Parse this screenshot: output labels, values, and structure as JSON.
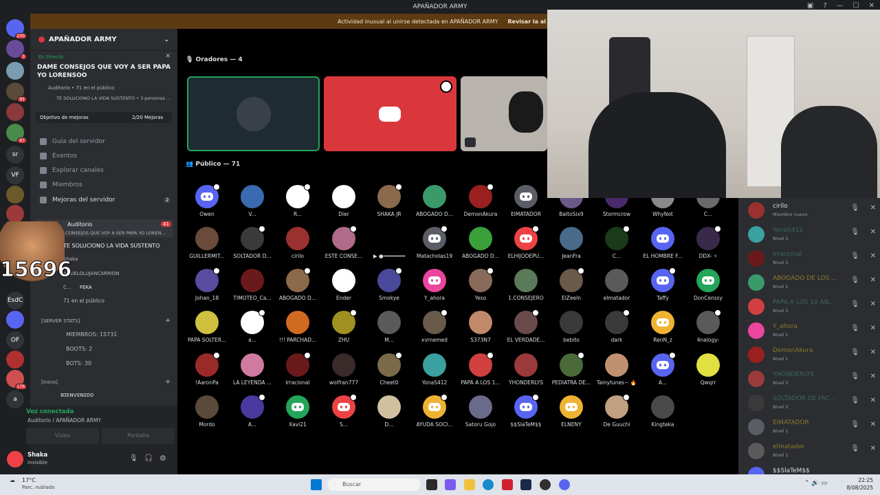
{
  "window": {
    "title": "APAÑADOR ARMY"
  },
  "alert": {
    "text": "Actividad inusual al unirse detectada en APAÑADOR ARMY",
    "action": "Revisar la al"
  },
  "rail": {
    "items": [
      {
        "label": "",
        "badge": "230",
        "color": "#5865f2"
      },
      {
        "label": "",
        "badge": "3",
        "color": "#6a4b9a"
      },
      {
        "label": "",
        "badge": "",
        "color": "#7a9bb0"
      },
      {
        "label": "",
        "badge": "91",
        "color": "#5a4a3a"
      },
      {
        "label": "",
        "badge": "",
        "color": "#8a3a3a"
      },
      {
        "label": "",
        "badge": "67",
        "color": "#4a8a4a"
      },
      {
        "label": "sr",
        "badge": "",
        "color": "#313338"
      },
      {
        "label": "VF",
        "badge": "",
        "color": "#313338"
      },
      {
        "label": "",
        "badge": "",
        "color": "#6a5a2a"
      },
      {
        "label": "",
        "badge": "",
        "color": "#9a3a3a"
      },
      {
        "label": "EsdC",
        "badge": "",
        "color": "#313338"
      },
      {
        "label": "",
        "badge": "",
        "color": "#5865f2"
      },
      {
        "label": "OF",
        "badge": "",
        "color": "#313338"
      },
      {
        "label": "",
        "badge": "",
        "color": "#b03030"
      },
      {
        "label": "",
        "badge": "176",
        "color": "#d05050"
      },
      {
        "label": "a",
        "badge": "",
        "color": "#313338"
      }
    ]
  },
  "server": {
    "name": "APAÑADOR ARMY",
    "live_label": "En Directo",
    "event_title": "DAME CONSEJOS QUE VOY A SER PAPA YO LORENSOO",
    "event_meta": "Auditorio • 71 en el público",
    "event_topic": "TE SOLUCIONO LA VIDA SUSTENTO • 3 personas ...",
    "boost_goal": "Objetivo de mejoras",
    "boost_count": "2/20 Mejoras",
    "nav": [
      "Guía del servidor",
      "Eventos",
      "Explorar canales",
      "Miembros",
      "Mejoras del servidor"
    ],
    "boost_badge": "2",
    "auditorio_label": "Auditorio",
    "auditorio_badge": "41",
    "auditorio_topic": "DAME CONSEJOS QUE VOY A SER PAPA YO LOREN...",
    "stage_topic": "TE SOLUCIONO LA VIDA SUSTENTO",
    "stage_users": [
      "Shaka",
      "AGUELOLUJANCARRION",
      "C...",
      "FEKA"
    ],
    "audience": "71 en el público",
    "stats_header": "[SERVER STATS]",
    "stats": [
      "MIEMBROS: 15731",
      "BOOTS: 2",
      "BOTS: 30"
    ],
    "inicio_header": "[inicio]",
    "welcome": "ʙɪᴇɴᴠᴇɴɪᴅᴏ",
    "overlay_number": "15696"
  },
  "voice": {
    "status": "Voz conectada",
    "channel": "Auditorio / APAÑADOR ARMY",
    "video": "Vídeo",
    "screen": "Pantalla"
  },
  "user": {
    "name": "Shaka",
    "status": "Invisible"
  },
  "stage": {
    "speakers_header": "Oradores — 4",
    "public_header": "Público — 71",
    "members": [
      [
        "Owen",
        "V...",
        "R...",
        "Dier",
        "SHAKA JR",
        "ABOGADO D...",
        "DemonAkura",
        "ElMATADOR",
        "BaltoSix9",
        "Stormcrow",
        "WhyNot",
        "C..."
      ],
      [
        "GUILLERMIT...",
        "SOLTADOR D...",
        "cirilo",
        "ESTE CONSE...",
        "▶ ●━━━━━━━",
        "Matacholas19",
        "ABOGADO D...",
        "ELHIJODEPU...",
        "JeanFra",
        "C...",
        "EL HOMBRE F...",
        "DDX- ⚡"
      ],
      [
        "Johan_18",
        "TIMOTEO_Ca...",
        "ABOGADO D...",
        "Ender",
        "Smokye",
        "Y_ahora",
        "Yeso",
        "1.CONSEJERO",
        "ElZeeln",
        "elmatador",
        "Taffy",
        "DonCenssy"
      ],
      [
        "PAPA SOLTER...",
        "a...",
        "!!! PARCHAD...",
        "ZHU",
        "M...",
        "xvrnemed",
        "S373N7",
        "EL VERDADE...",
        "bebito",
        "dark",
        "RenN_z",
        "4nalogy-"
      ],
      [
        "!AaronPa",
        "LA LEYENDA ...",
        "Irracional",
        "wolfran777",
        "Cheet0",
        "YonaS412",
        "PAPÁ A LOS 1...",
        "YHONDERLYS",
        "PEDIATRA DE...",
        "Tainytunes~ 🔥",
        "A...",
        "Qwqrr"
      ],
      [
        "Mordo",
        "A...",
        "Xavi21",
        "S...",
        "D...",
        "AYUDA SOCI...",
        "Satoru Gojo",
        "$$SlaTeM$$",
        "ELNENY",
        "De Guuchi",
        "Kingteka",
        ""
      ]
    ],
    "colors": [
      [
        "#5865f2",
        "#3a6ab0",
        "#ffffff",
        "#ffffff",
        "#8a6a4a",
        "#3a9a6a",
        "#9a2020",
        "#5a5d65",
        "#6a5a8a",
        "#4a2a6a",
        "#8a8a8a",
        "#6a6a6a"
      ],
      [
        "#6a4a3a",
        "#3a3a3a",
        "#9a3030",
        "#b06a8a",
        "#000000",
        "#5a5d65",
        "#3aa03a",
        "#ed4245",
        "#4a6a8a",
        "#1a3a1a",
        "#5865f2",
        "#3a2a4a"
      ],
      [
        "#5a4aa0",
        "#6a1a1a",
        "#8a6a4a",
        "#ffffff",
        "#4a4a9a",
        "#eb459e",
        "#8a6a5a",
        "#5a7a5a",
        "#6a5a4a",
        "#5a5a5a",
        "#5865f2",
        "#23a55a"
      ],
      [
        "#d0c040",
        "#ffffff",
        "#d06a20",
        "#a09020",
        "#5a5a5a",
        "#6a5a4a",
        "#c08a6a",
        "#6a4a4a",
        "#3a3a3a",
        "#3a3a3a",
        "#f0b232",
        "#5a5a5a"
      ],
      [
        "#9a2a2a",
        "#d07aa0",
        "#6a1a1a",
        "#3a2a2a",
        "#7a6a4a",
        "#3aa0a0",
        "#d04040",
        "#9a3a3a",
        "#4a6a3a",
        "#c09070",
        "#5865f2",
        "#e0e040"
      ],
      [
        "#5a4a3a",
        "#4a3aa0",
        "#23a55a",
        "#ed4245",
        "#d0c0a0",
        "#f0b232",
        "#6a6a8a",
        "#5865f2",
        "#f0b232",
        "#c0a080",
        "#4a4a4a",
        "#000000"
      ]
    ]
  },
  "right_list": [
    {
      "name": "cirilo",
      "sub": "Miembro nuevo",
      "color": "#dbdee1",
      "av": "#9a3030"
    },
    {
      "name": "YonaS412",
      "sub": "Nivel 5",
      "color": "#3a6a5a",
      "av": "#3aa0a0"
    },
    {
      "name": "Irracional",
      "sub": "Nivel 5",
      "color": "#3a6a5a",
      "av": "#6a1a1a"
    },
    {
      "name": "ABOGADO DE LOS ...",
      "sub": "Nivel 1",
      "color": "#8a7a2a",
      "av": "#3a9a6a"
    },
    {
      "name": "PAPÁ A LOS 10 AN...",
      "sub": "Nivel 5",
      "color": "#3a6a5a",
      "av": "#d04040"
    },
    {
      "name": "Y_ahora",
      "sub": "Nivel 1",
      "color": "#8a7a2a",
      "av": "#eb459e"
    },
    {
      "name": "DemonAkura",
      "sub": "Nivel 1",
      "color": "#8a7a2a",
      "av": "#9a2020"
    },
    {
      "name": "YHONDERLYS",
      "sub": "Nivel 5",
      "color": "#3a6a5a",
      "av": "#9a3a3a"
    },
    {
      "name": "SOLTADOR DE FAC...",
      "sub": "Nivel 5",
      "color": "#3a6a5a",
      "av": "#3a3a3a"
    },
    {
      "name": "ElMATADOR",
      "sub": "Nivel 1",
      "color": "#8a7a2a",
      "av": "#5a5d65"
    },
    {
      "name": "elmatador",
      "sub": "Nivel 1",
      "color": "#8a7a2a",
      "av": "#5a5a5a"
    },
    {
      "name": "$$SlaTeM$$",
      "sub": "",
      "color": "#dbdee1",
      "av": "#5865f2"
    }
  ],
  "taskbar": {
    "weather": "17°C",
    "weather_sub": "Parc. nublado",
    "search": "Buscar",
    "time": "22:25",
    "date": "8/08/2025"
  }
}
